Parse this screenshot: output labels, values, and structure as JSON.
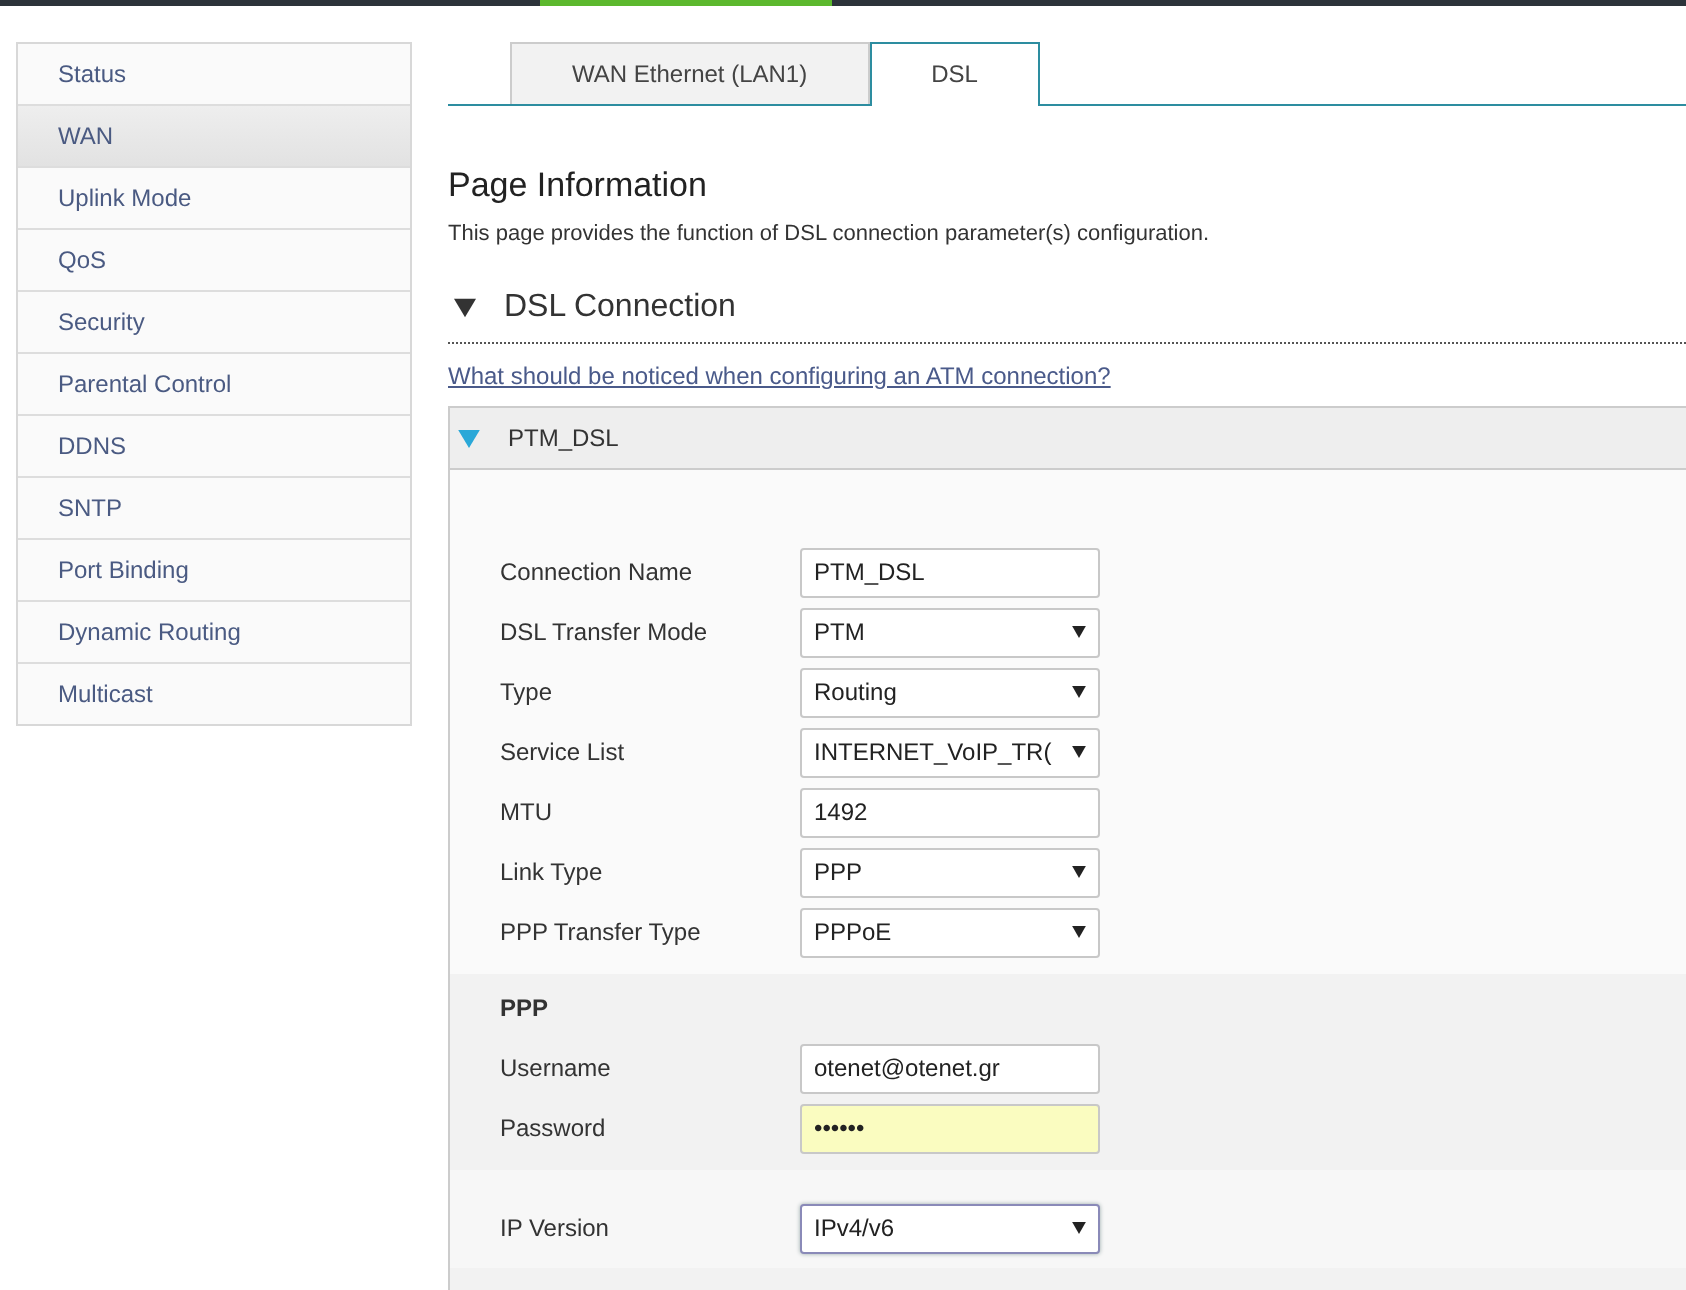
{
  "sidebar": {
    "items": [
      {
        "label": "Status",
        "selected": false
      },
      {
        "label": "WAN",
        "selected": true
      },
      {
        "label": "Uplink Mode",
        "selected": false
      },
      {
        "label": "QoS",
        "selected": false
      },
      {
        "label": "Security",
        "selected": false
      },
      {
        "label": "Parental Control",
        "selected": false
      },
      {
        "label": "DDNS",
        "selected": false
      },
      {
        "label": "SNTP",
        "selected": false
      },
      {
        "label": "Port Binding",
        "selected": false
      },
      {
        "label": "Dynamic Routing",
        "selected": false
      },
      {
        "label": "Multicast",
        "selected": false
      }
    ]
  },
  "tabs": [
    {
      "label": "WAN Ethernet (LAN1)",
      "selected": false
    },
    {
      "label": "DSL",
      "selected": true
    }
  ],
  "page_info": {
    "title": "Page Information",
    "description": "This page provides the function of DSL connection parameter(s) configuration."
  },
  "section": {
    "title": "DSL Connection",
    "expanded": true,
    "help_link": "What should be noticed when configuring an ATM connection?"
  },
  "connection": {
    "name": "PTM_DSL",
    "expanded": true,
    "groups": [
      {
        "fields": [
          {
            "label": "Connection Name",
            "kind": "text",
            "value": "PTM_DSL",
            "focused": false
          },
          {
            "label": "DSL Transfer Mode",
            "kind": "select",
            "value": "PTM",
            "focused": false
          },
          {
            "label": "Type",
            "kind": "select",
            "value": "Routing",
            "focused": false
          },
          {
            "label": "Service List",
            "kind": "select",
            "value": "INTERNET_VoIP_TR(",
            "focused": false
          },
          {
            "label": "MTU",
            "kind": "text",
            "value": "1492",
            "focused": false
          },
          {
            "label": "Link Type",
            "kind": "select",
            "value": "PPP",
            "focused": false
          },
          {
            "label": "PPP Transfer Type",
            "kind": "select",
            "value": "PPPoE",
            "focused": false
          }
        ]
      },
      {
        "title": "PPP",
        "fields": [
          {
            "label": "Username",
            "kind": "text",
            "value": "otenet@otenet.gr",
            "focused": false
          },
          {
            "label": "Password",
            "kind": "password",
            "value": "••••••",
            "focused": false
          }
        ]
      },
      {
        "fields": [
          {
            "label": "IP Version",
            "kind": "select",
            "value": "IPv4/v6",
            "focused": true
          }
        ]
      }
    ]
  }
}
